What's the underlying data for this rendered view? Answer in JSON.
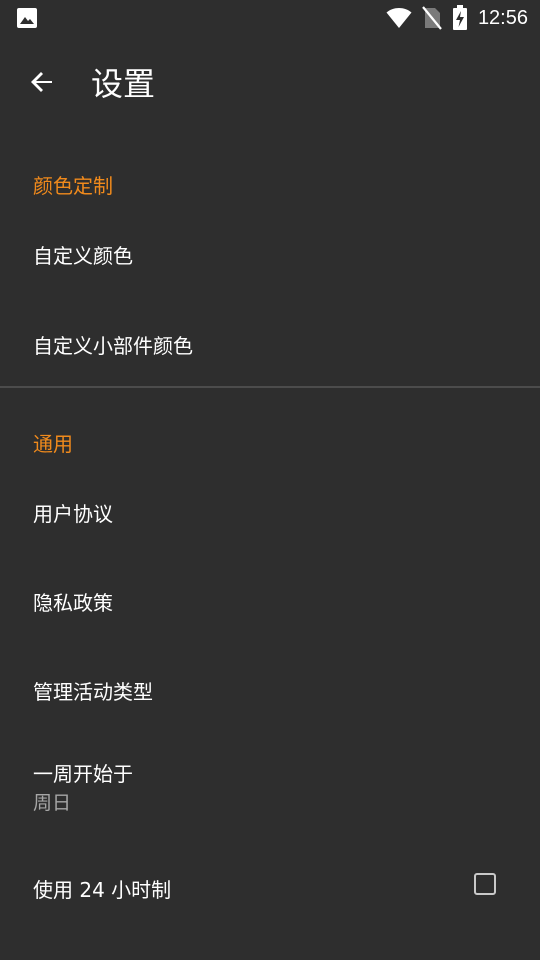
{
  "status_bar": {
    "time": "12:56",
    "left_icon": "image-notification-icon",
    "right_icons": [
      "wifi-icon",
      "no-sim-icon",
      "battery-charging-icon"
    ]
  },
  "toolbar": {
    "back_icon": "arrow-left-icon",
    "title": "设置"
  },
  "sections": {
    "color": {
      "header": "颜色定制",
      "items": [
        {
          "title": "自定义颜色"
        },
        {
          "title": "自定义小部件颜色"
        }
      ]
    },
    "general": {
      "header": "通用",
      "items": [
        {
          "title": "用户协议"
        },
        {
          "title": "隐私政策"
        },
        {
          "title": "管理活动类型"
        },
        {
          "title": "一周开始于",
          "summary": "周日"
        },
        {
          "title": "使用 24 小时制",
          "checked": false
        }
      ]
    }
  },
  "colors": {
    "background": "#2e2e2e",
    "accent": "#f08a1c",
    "text_primary": "#ffffff",
    "text_secondary": "#a6a6a6",
    "divider": "#4c4c4c"
  }
}
